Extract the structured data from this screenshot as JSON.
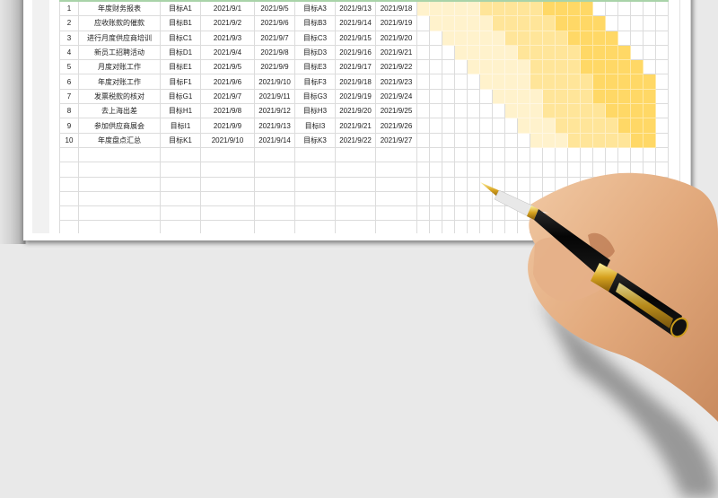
{
  "sheet": {
    "columns": [
      "no",
      "task",
      "goal_1",
      "start_date",
      "mid_date",
      "goal_3",
      "date_3",
      "end_date"
    ],
    "gantt_columns": 20,
    "colors": {
      "light": "#FFF2CC",
      "medium": "#FFE599",
      "dark": "#FFD866",
      "header_border": "#A9D3A9",
      "grid": "#DCDCDC"
    },
    "rows": [
      {
        "no": "1",
        "task": "年度财务报表",
        "goal_1": "目标A1",
        "start_date": "2021/9/1",
        "mid_date": "2021/9/5",
        "goal_3": "目标A3",
        "date_3": "2021/9/13",
        "end_date": "2021/9/18",
        "gantt": {
          "light": [
            0,
            4
          ],
          "medium": [
            5,
            9
          ],
          "dark": [
            10,
            13
          ]
        }
      },
      {
        "no": "2",
        "task": "应收账款的催款",
        "goal_1": "目标B1",
        "start_date": "2021/9/2",
        "mid_date": "2021/9/6",
        "goal_3": "目标B3",
        "date_3": "2021/9/14",
        "end_date": "2021/9/19",
        "gantt": {
          "light": [
            1,
            5
          ],
          "medium": [
            6,
            10
          ],
          "dark": [
            11,
            14
          ]
        }
      },
      {
        "no": "3",
        "task": "进行月度供应商培训",
        "goal_1": "目标C1",
        "start_date": "2021/9/3",
        "mid_date": "2021/9/7",
        "goal_3": "目标C3",
        "date_3": "2021/9/15",
        "end_date": "2021/9/20",
        "gantt": {
          "light": [
            2,
            6
          ],
          "medium": [
            7,
            11
          ],
          "dark": [
            12,
            15
          ]
        }
      },
      {
        "no": "4",
        "task": "新员工招聘活动",
        "goal_1": "目标D1",
        "start_date": "2021/9/4",
        "mid_date": "2021/9/8",
        "goal_3": "目标D3",
        "date_3": "2021/9/16",
        "end_date": "2021/9/21",
        "gantt": {
          "light": [
            3,
            7
          ],
          "medium": [
            8,
            12
          ],
          "dark": [
            13,
            16
          ]
        }
      },
      {
        "no": "5",
        "task": "月度对账工作",
        "goal_1": "目标E1",
        "start_date": "2021/9/5",
        "mid_date": "2021/9/9",
        "goal_3": "目标E3",
        "date_3": "2021/9/17",
        "end_date": "2021/9/22",
        "gantt": {
          "light": [
            4,
            8
          ],
          "medium": [
            9,
            12
          ],
          "dark": [
            13,
            17
          ]
        }
      },
      {
        "no": "6",
        "task": "年度对账工作",
        "goal_1": "目标F1",
        "start_date": "2021/9/6",
        "mid_date": "2021/9/10",
        "goal_3": "目标F3",
        "date_3": "2021/9/18",
        "end_date": "2021/9/23",
        "gantt": {
          "light": [
            5,
            8
          ],
          "medium": [
            9,
            13
          ],
          "dark": [
            14,
            18
          ]
        }
      },
      {
        "no": "7",
        "task": "发票税款的核对",
        "goal_1": "目标G1",
        "start_date": "2021/9/7",
        "mid_date": "2021/9/11",
        "goal_3": "目标G3",
        "date_3": "2021/9/19",
        "end_date": "2021/9/24",
        "gantt": {
          "light": [
            6,
            9
          ],
          "medium": [
            10,
            13
          ],
          "dark": [
            14,
            18
          ]
        }
      },
      {
        "no": "8",
        "task": "去上海出差",
        "goal_1": "目标H1",
        "start_date": "2021/9/8",
        "mid_date": "2021/9/12",
        "goal_3": "目标H3",
        "date_3": "2021/9/20",
        "end_date": "2021/9/25",
        "gantt": {
          "light": [
            7,
            9
          ],
          "medium": [
            10,
            14
          ],
          "dark": [
            15,
            18
          ]
        }
      },
      {
        "no": "9",
        "task": "参加供应商展会",
        "goal_1": "目标I1",
        "start_date": "2021/9/9",
        "mid_date": "2021/9/13",
        "goal_3": "目标I3",
        "date_3": "2021/9/21",
        "end_date": "2021/9/26",
        "gantt": {
          "light": [
            8,
            10
          ],
          "medium": [
            11,
            15
          ],
          "dark": [
            16,
            18
          ]
        }
      },
      {
        "no": "10",
        "task": "年度盘点汇总",
        "goal_1": "目标K1",
        "start_date": "2021/9/10",
        "mid_date": "2021/9/14",
        "goal_3": "目标K3",
        "date_3": "2021/9/22",
        "end_date": "2021/9/27",
        "gantt": {
          "light": [
            9,
            11
          ],
          "medium": [
            12,
            16
          ],
          "dark": [
            17,
            18
          ]
        }
      }
    ],
    "empty_rows": 6
  }
}
